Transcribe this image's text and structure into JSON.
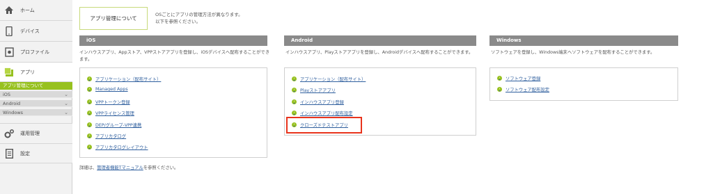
{
  "sidebar": {
    "items": [
      {
        "label": "ホーム",
        "icon": "home-icon"
      },
      {
        "label": "デバイス",
        "icon": "device-icon"
      },
      {
        "label": "プロファイル",
        "icon": "profile-icon"
      },
      {
        "label": "アプリ",
        "icon": "apps-icon"
      },
      {
        "label": "運用管理",
        "icon": "operations-icon"
      },
      {
        "label": "設定",
        "icon": "settings-icon"
      }
    ],
    "submenu": {
      "active": "アプリ管理について",
      "rows": [
        "iOS",
        "Android",
        "Windows"
      ]
    }
  },
  "intro": {
    "box_label": "アプリ管理について",
    "note_line1": "OSごとにアプリの管理方法が異なります。",
    "note_line2": "以下を参照ください。"
  },
  "columns": {
    "ios": {
      "title": "iOS",
      "description": "インハウスアプリ、Appストア、VPPストアアプリを登録し、iOSデバイスへ配布することができます。",
      "links": [
        "アプリケーション（配布サイト）",
        "Managed Apps",
        "VPPトークン登録",
        "VPPライセンス管理",
        "DEP/グループ-VPP連携",
        "アプリカタログ",
        "アプリカタログレイアウト"
      ]
    },
    "android": {
      "title": "Android",
      "description": "インハウスアプリ、Playストアアプリを登録し、Androidデバイスへ配布することができます。",
      "links": [
        "アプリケーション（配布サイト）",
        "Playストアアプリ",
        "インハウスアプリ登録",
        "インハウスアプリ配布設定",
        "クローズドテストアプリ"
      ]
    },
    "windows": {
      "title": "Windows",
      "description": "ソフトウェアを登録し、Windows端末へソフトウェアを配布することができます。",
      "links": [
        "ソフトウェア登録",
        "ソフトウェア配布設定"
      ]
    }
  },
  "footer": {
    "prefix": "詳細は、",
    "link": "管理者機能Tマニュアル",
    "suffix": "を参照ください。"
  },
  "colors": {
    "accent_green": "#97c11f",
    "header_gray": "#8a8a8a",
    "highlight_red": "#e8331c",
    "link_blue": "#2f5f9e"
  }
}
